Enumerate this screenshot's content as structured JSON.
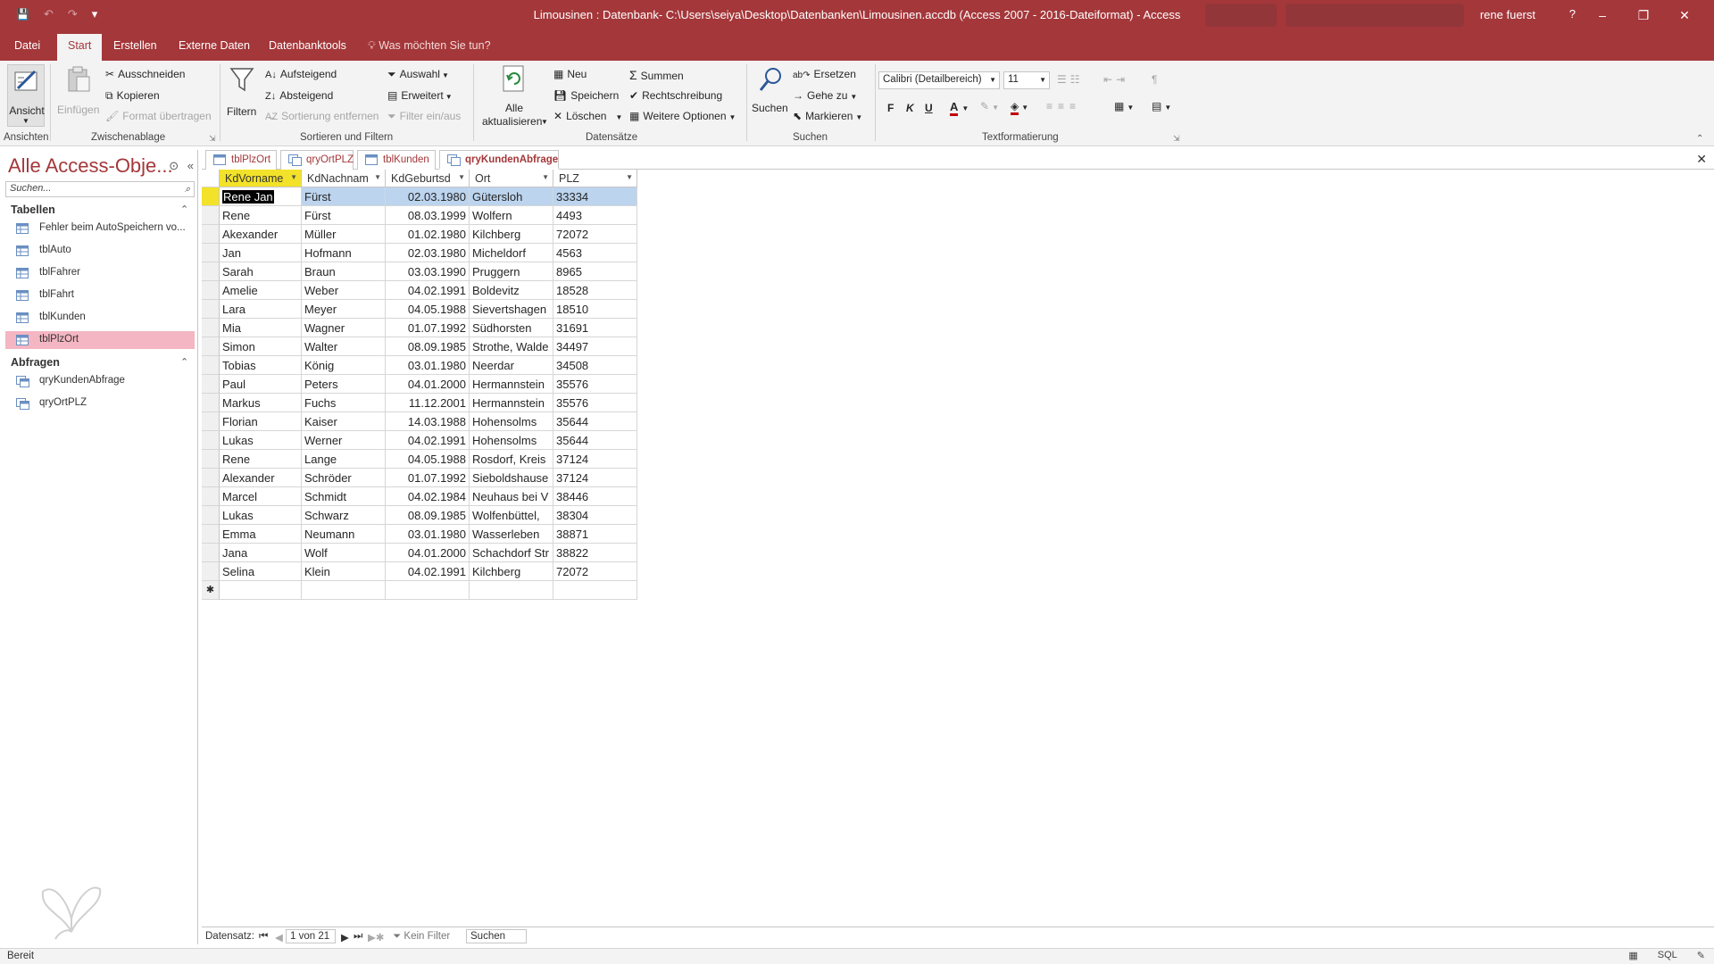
{
  "window": {
    "title": "Limousinen : Datenbank- C:\\Users\\seiya\\Desktop\\Datenbanken\\Limousinen.accdb (Access 2007 - 2016-Dateiformat)  -  Access",
    "user": "rene fuerst",
    "help": "?",
    "minimize": "–",
    "restore": "❐",
    "close": "✕"
  },
  "qat": {
    "save": "💾",
    "undo": "↶",
    "redo": "↷",
    "customize": "▾"
  },
  "ribbon_tabs": [
    "Datei",
    "Start",
    "Erstellen",
    "Externe Daten",
    "Datenbanktools"
  ],
  "tell_me": "Was möchten Sie tun?",
  "ribbon": {
    "ansicht": "Ansicht",
    "einfuegen": "Einfügen",
    "ausschneiden": "Ausschneiden",
    "kopieren": "Kopieren",
    "format_uebertragen": "Format übertragen",
    "filtern": "Filtern",
    "aufsteigend": "Aufsteigend",
    "absteigend": "Absteigend",
    "sortierung_entfernen": "Sortierung entfernen",
    "auswahl": "Auswahl",
    "erweitert": "Erweitert",
    "filter_ein_aus": "Filter ein/aus",
    "alle_aktualisieren_1": "Alle",
    "alle_aktualisieren_2": "aktualisieren",
    "neu": "Neu",
    "speichern": "Speichern",
    "loeschen": "Löschen",
    "summen": "Summen",
    "rechtschreibung": "Rechtschreibung",
    "weitere_optionen": "Weitere Optionen",
    "suchen_btn": "Suchen",
    "ersetzen": "Ersetzen",
    "gehe_zu": "Gehe zu",
    "markieren": "Markieren",
    "font_name": "Calibri (Detailbereich)",
    "font_size": "11",
    "bold": "F",
    "italic": "K",
    "underline": "U",
    "groups": {
      "ansichten": "Ansichten",
      "zwischenablage": "Zwischenablage",
      "sortieren_filtern": "Sortieren und Filtern",
      "datensaetze": "Datensätze",
      "suchen": "Suchen",
      "textformatierung": "Textformatierung"
    }
  },
  "nav": {
    "title": "Alle Access-Obje...",
    "search_placeholder": "Suchen...",
    "sections": {
      "tabellen": "Tabellen",
      "abfragen": "Abfragen"
    },
    "tables": [
      "Fehler beim AutoSpeichern vo...",
      "tblAuto",
      "tblFahrer",
      "tblFahrt",
      "tblKunden",
      "tblPlzOrt"
    ],
    "queries": [
      "qryKundenAbfrage",
      "qryOrtPLZ"
    ]
  },
  "doc_tabs": [
    "tblPlzOrt",
    "qryOrtPLZ",
    "tblKunden",
    "qryKundenAbfrage"
  ],
  "columns": [
    "KdVorname",
    "KdNachnam",
    "KdGeburtsd",
    "Ort",
    "PLZ"
  ],
  "rows": [
    [
      "Rene Jan",
      "Fürst",
      "02.03.1980",
      "Gütersloh",
      "33334"
    ],
    [
      "Rene",
      "Fürst",
      "08.03.1999",
      "Wolfern",
      "4493"
    ],
    [
      "Akexander",
      "Müller",
      "01.02.1980",
      "Kilchberg",
      "72072"
    ],
    [
      "Jan",
      "Hofmann",
      "02.03.1980",
      "Micheldorf",
      "4563"
    ],
    [
      "Sarah",
      "Braun",
      "03.03.1990",
      "Pruggern",
      "8965"
    ],
    [
      "Amelie",
      "Weber",
      "04.02.1991",
      "Boldevitz",
      "18528"
    ],
    [
      "Lara",
      "Meyer",
      "04.05.1988",
      "Sievertshagen",
      "18510"
    ],
    [
      "Mia",
      "Wagner",
      "01.07.1992",
      "Südhorsten",
      "31691"
    ],
    [
      "Simon",
      "Walter",
      "08.09.1985",
      "Strothe, Walde",
      "34497"
    ],
    [
      "Tobias",
      "König",
      "03.01.1980",
      "Neerdar",
      "34508"
    ],
    [
      "Paul",
      "Peters",
      "04.01.2000",
      "Hermannstein",
      "35576"
    ],
    [
      "Markus",
      "Fuchs",
      "11.12.2001",
      "Hermannstein",
      "35576"
    ],
    [
      "Florian",
      "Kaiser",
      "14.03.1988",
      "Hohensolms",
      "35644"
    ],
    [
      "Lukas",
      "Werner",
      "04.02.1991",
      "Hohensolms",
      "35644"
    ],
    [
      "Rene",
      "Lange",
      "04.05.1988",
      "Rosdorf, Kreis",
      "37124"
    ],
    [
      "Alexander",
      "Schröder",
      "01.07.1992",
      "Sieboldshause",
      "37124"
    ],
    [
      "Marcel",
      "Schmidt",
      "04.02.1984",
      "Neuhaus bei V",
      "38446"
    ],
    [
      "Lukas",
      "Schwarz",
      "08.09.1985",
      "Wolfenbüttel,",
      "38304"
    ],
    [
      "Emma",
      "Neumann",
      "03.01.1980",
      "Wasserleben",
      "38871"
    ],
    [
      "Jana",
      "Wolf",
      "04.01.2000",
      "Schachdorf Str",
      "38822"
    ],
    [
      "Selina",
      "Klein",
      "04.02.1991",
      "Kilchberg",
      "72072"
    ]
  ],
  "new_row_marker": "✱",
  "recnav": {
    "label": "Datensatz:",
    "position": "1 von 21",
    "filter": "Kein Filter",
    "search": "Suchen"
  },
  "status": {
    "text": "Bereit",
    "sql": "SQL"
  },
  "colors": {
    "brand": "#a4373a",
    "active_header": "#f3e22a",
    "selected_row": "#bcd4ee",
    "nav_selected": "#f4b6c2"
  }
}
